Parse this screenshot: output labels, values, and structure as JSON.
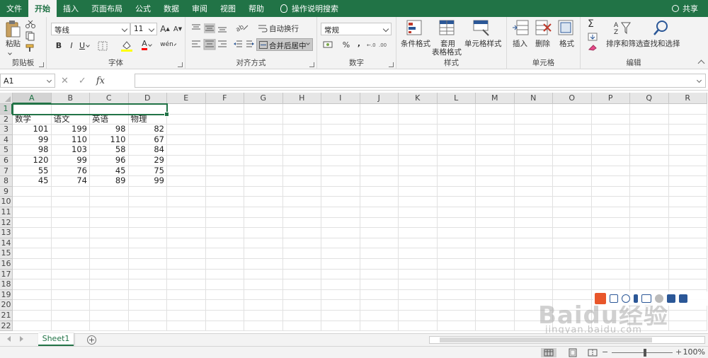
{
  "menu": {
    "tabs": [
      "文件",
      "开始",
      "插入",
      "页面布局",
      "公式",
      "数据",
      "审阅",
      "视图",
      "帮助"
    ],
    "active_index": 1,
    "search_label": "操作说明搜索",
    "share_label": "共享"
  },
  "ribbon": {
    "clipboard": {
      "paste_label": "粘贴",
      "group_label": "剪贴板"
    },
    "font": {
      "family": "等线",
      "size": "11",
      "increase": "A",
      "decrease": "A",
      "bold": "B",
      "italic": "I",
      "underline": "U",
      "wen": "wén",
      "group_label": "字体",
      "fill_color": "#ffff00",
      "font_color": "#ff0000"
    },
    "alignment": {
      "wrap_label": "自动换行",
      "merge_label": "合并后居中",
      "group_label": "对齐方式"
    },
    "number": {
      "format": "常规",
      "percent": "%",
      "comma": ",",
      "group_label": "数字"
    },
    "styles": {
      "conditional_label": "条件格式",
      "table_label_1": "套用",
      "table_label_2": "表格格式",
      "cell_styles_label": "单元格样式",
      "group_label": "样式"
    },
    "cells": {
      "insert_label": "插入",
      "delete_label": "删除",
      "format_label": "格式",
      "group_label": "单元格"
    },
    "editing": {
      "sum_symbol": "Σ",
      "sort_label": "排序和筛选",
      "find_label": "查找和选择",
      "group_label": "编辑"
    }
  },
  "formula_bar": {
    "name_box": "A1",
    "cancel": "✕",
    "enter": "✓",
    "fx": "fx",
    "content": ""
  },
  "sheet": {
    "columns": [
      "A",
      "B",
      "C",
      "D",
      "E",
      "F",
      "G",
      "H",
      "I",
      "J",
      "K",
      "L",
      "M",
      "N",
      "O",
      "P",
      "Q",
      "R"
    ],
    "rows": [
      "1",
      "2",
      "3",
      "4",
      "5",
      "6",
      "7",
      "8",
      "9",
      "10",
      "11",
      "12",
      "13",
      "14",
      "15",
      "16",
      "17",
      "18",
      "19",
      "20",
      "21",
      "22"
    ],
    "headers": [
      "数学",
      "语文",
      "英语",
      "物理"
    ],
    "data": [
      [
        "101",
        "199",
        "98",
        "82"
      ],
      [
        "99",
        "110",
        "110",
        "67"
      ],
      [
        "98",
        "103",
        "58",
        "84"
      ],
      [
        "120",
        "99",
        "96",
        "29"
      ],
      [
        "55",
        "76",
        "45",
        "75"
      ],
      [
        "45",
        "74",
        "89",
        "99"
      ]
    ]
  },
  "sheet_tabs": {
    "active": "Sheet1",
    "add": "+"
  },
  "status": {
    "zoom": "100%",
    "minus": "−",
    "plus": "+"
  },
  "watermark": {
    "main": "Baidu经验",
    "sub": "jingyan.baidu.com"
  },
  "theme": {
    "accent": "#217346"
  }
}
